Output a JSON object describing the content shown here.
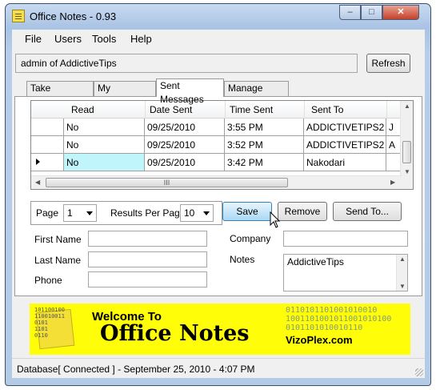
{
  "window": {
    "title": "Office Notes - 0.93",
    "controls": {
      "minimize": "–",
      "maximize": "□",
      "close": "✕"
    }
  },
  "menu": {
    "items": [
      "File",
      "Users",
      "Tools",
      "Help"
    ]
  },
  "user": {
    "label": "admin of AddictiveTips",
    "refresh_label": "Refresh"
  },
  "tabs": [
    {
      "label": "Take Message",
      "active": false
    },
    {
      "label": "My Messages",
      "active": false
    },
    {
      "label": "Sent Messages",
      "active": true
    },
    {
      "label": "Manage Users",
      "active": false
    }
  ],
  "grid": {
    "columns": [
      "Read",
      "Date Sent",
      "Time Sent",
      "Sent To"
    ],
    "rows": [
      {
        "read": "No",
        "date": "09/25/2010",
        "time": "3:55 PM",
        "to": "ADDICTIVETIPS2",
        "extra": "J"
      },
      {
        "read": "No",
        "date": "09/25/2010",
        "time": "3:52 PM",
        "to": "ADDICTIVETIPS2",
        "extra": "A"
      },
      {
        "read": "No",
        "date": "09/25/2010",
        "time": "3:42 PM",
        "to": "Nakodari",
        "extra": ""
      }
    ],
    "scroll_thumb_label": "III"
  },
  "pager": {
    "page_label": "Page",
    "page_value": "1",
    "results_label": "Results Per Page",
    "results_value": "10"
  },
  "actions": {
    "save": "Save",
    "remove": "Remove",
    "send_to": "Send To..."
  },
  "form": {
    "first_name_label": "First Name",
    "last_name_label": "Last Name",
    "phone_label": "Phone",
    "company_label": "Company",
    "notes_label": "Notes",
    "notes_value": "AddictiveTips",
    "first_name_value": "",
    "last_name_value": "",
    "phone_value": "",
    "company_value": ""
  },
  "banner": {
    "welcome": "Welcome To",
    "brand": "Office Notes",
    "url": "VizoPlex.com",
    "binary_small": "101100100\n110010011\n0101\n1101\n0110",
    "bits": "0110101101001010010\n1001101001011001010100\n0101101010010110"
  },
  "status": {
    "text": "Database[ Connected ] - September 25, 2010 - 4:07 PM"
  }
}
